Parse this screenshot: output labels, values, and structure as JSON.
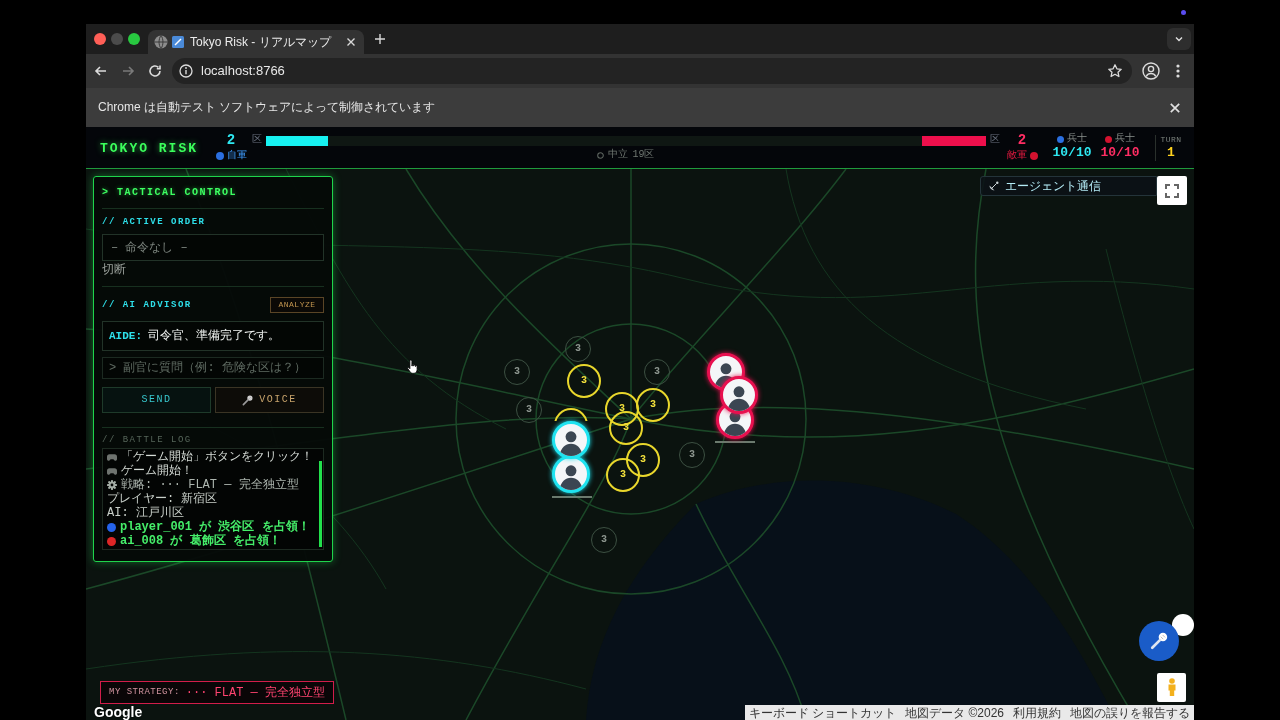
{
  "browser": {
    "tab": {
      "title": "Tokyo Risk - リアルマップ"
    },
    "address": "localhost:8766",
    "infobar": {
      "text": "Chrome は自動テスト ソフトウェアによって制御されています"
    }
  },
  "header": {
    "logo": "TOKYO RISK",
    "player": {
      "count": "2",
      "unit": "区",
      "label": "自軍",
      "level": 0.086
    },
    "neutral": {
      "label": "中立",
      "count": "19区"
    },
    "enemy": {
      "count": "2",
      "unit": "区",
      "label": "敵軍",
      "level": 0.089
    },
    "troops": [
      {
        "kind": "player",
        "label": "兵士",
        "value": "10/10"
      },
      {
        "kind": "enemy",
        "label": "兵士",
        "value": "10/10"
      }
    ],
    "turn": {
      "label": "TURN",
      "value": "1"
    }
  },
  "panel": {
    "title": "> TACTICAL CONTROL",
    "active_order": {
      "heading": "// ACTIVE ORDER",
      "value": "– 命令なし –",
      "status": "切断"
    },
    "advisor": {
      "heading": "// AI ADVISOR",
      "analyze_button": "ANALYZE",
      "speaker": "AIDE:",
      "message": "司令官、準備完了です。",
      "placeholder": "> 副官に質問（例: 危険な区は？）",
      "send_button": "SEND",
      "voice_button": "VOICE"
    },
    "battle_log": {
      "heading": "// BATTLE LOG",
      "entries": [
        {
          "kind": "event",
          "text": "「ゲーム開始」ボタンをクリック！"
        },
        {
          "kind": "event",
          "text": "ゲーム開始！"
        },
        {
          "kind": "setting",
          "text": "戦略: ··· FLAT — 完全独立型"
        },
        {
          "kind": "info",
          "text": "プレイヤー: 新宿区"
        },
        {
          "kind": "info",
          "text": "AI: 江戸川区"
        },
        {
          "kind": "capture",
          "color": "#2563eb",
          "text": "player_001 が 渋谷区 を占領！"
        },
        {
          "kind": "capture",
          "color": "#dc2626",
          "text": "ai_008 が 葛飾区 を占領！"
        }
      ]
    }
  },
  "map": {
    "agent_panel": {
      "title": "エージェント通信"
    },
    "territories": [
      {
        "troops": "3",
        "highlighted": true
      },
      {
        "troops": "3",
        "highlighted": true
      },
      {
        "troops": "3",
        "highlighted": true
      },
      {
        "troops": "3",
        "highlighted": true
      },
      {
        "troops": "3",
        "highlighted": true
      },
      {
        "troops": "3",
        "highlighted": true
      },
      {
        "highlighted": true
      },
      {
        "troops": "3",
        "highlighted": false
      },
      {
        "troops": "3",
        "highlighted": false
      },
      {
        "troops": "3",
        "highlighted": false
      },
      {
        "troops": "3",
        "highlighted": false
      },
      {
        "troops": "3",
        "highlighted": false
      },
      {
        "troops": "3",
        "highlighted": false
      }
    ],
    "units": [
      {
        "color": "#1fe3f0"
      },
      {
        "color": "#1fe3f0"
      },
      {
        "color": "#e8104f"
      },
      {
        "color": "#e8104f"
      },
      {
        "color": "#e8104f"
      }
    ],
    "strategy": {
      "label": "MY STRATEGY:",
      "value": "··· FLAT — 完全独立型"
    },
    "logo": "Google",
    "attribution": [
      "キーボード ショートカット",
      "地図データ ©2026",
      "利用規約",
      "地図の誤りを報告する"
    ]
  }
}
